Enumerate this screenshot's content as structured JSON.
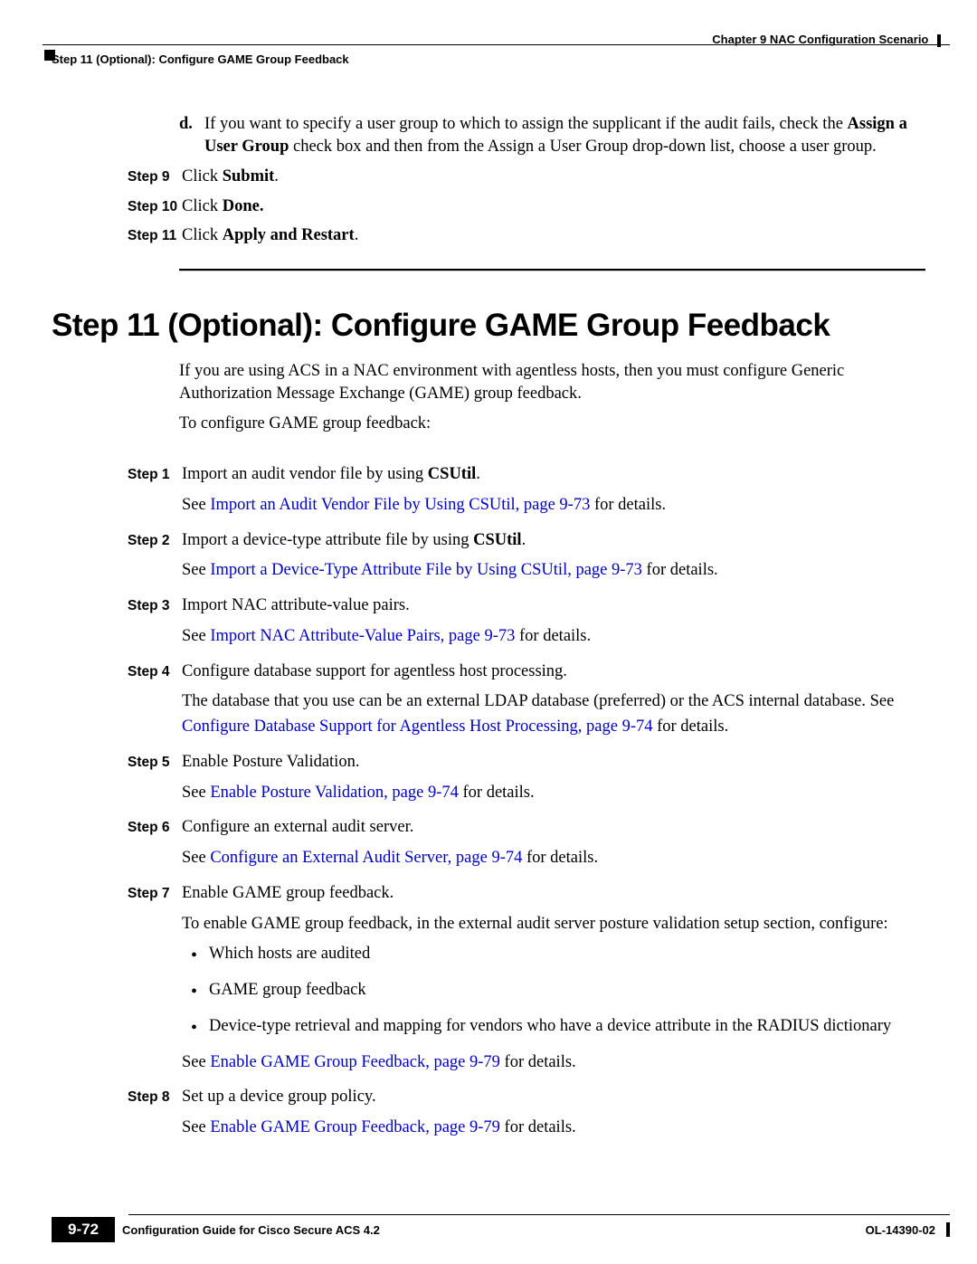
{
  "header": {
    "chapter": "Chapter 9    NAC Configuration Scenario",
    "section": "Step 11 (Optional): Configure GAME Group Feedback"
  },
  "prior": {
    "subD": {
      "marker": "d.",
      "pre": "If you want to specify a user group to which to assign the supplicant if the audit fails, check the ",
      "bold": "Assign a User Group",
      "post": " check box and then from the Assign a User Group drop-down list, choose a user group."
    },
    "steps": [
      {
        "label": "Step 9",
        "pre": "Click ",
        "bold": "Submit",
        "post": "."
      },
      {
        "label": "Step 10",
        "pre": "Click ",
        "bold": "Done.",
        "post": ""
      },
      {
        "label": "Step 11",
        "pre": "Click ",
        "bold": "Apply and Restart",
        "post": "."
      }
    ]
  },
  "title": "Step 11 (Optional): Configure GAME Group Feedback",
  "intro": [
    "If you are using ACS in a NAC environment with agentless hosts, then you must configure Generic Authorization Message Exchange (GAME) group feedback.",
    "To configure GAME group feedback:"
  ],
  "mainSteps": {
    "s1": {
      "label": "Step 1",
      "line1_pre": "Import an audit vendor file by using ",
      "line1_bold": "CSUtil",
      "line1_post": ".",
      "see_pre": "See ",
      "see_link": "Import an Audit Vendor File by Using CSUtil, page 9-73",
      "see_post": " for details."
    },
    "s2": {
      "label": "Step 2",
      "line1_pre": "Import a device-type attribute file by using ",
      "line1_bold": "CSUtil",
      "line1_post": ".",
      "see_pre": "See ",
      "see_link": "Import a Device-Type Attribute File by Using CSUtil, page 9-73",
      "see_post": " for details."
    },
    "s3": {
      "label": "Step 3",
      "line1": "Import NAC attribute-value pairs.",
      "see_pre": "See ",
      "see_link": "Import NAC Attribute-Value Pairs, page 9-73",
      "see_post": " for details."
    },
    "s4": {
      "label": "Step 4",
      "line1": "Configure database support for agentless host processing.",
      "extra": "The database that you use can be an external LDAP database (preferred) or the ACS internal database. See ",
      "see_link": "Configure Database Support for Agentless Host Processing, page 9-74",
      "see_post": " for details."
    },
    "s5": {
      "label": "Step 5",
      "line1": "Enable Posture Validation.",
      "see_pre": "See ",
      "see_link": "Enable Posture Validation, page 9-74",
      "see_post": " for details."
    },
    "s6": {
      "label": "Step 6",
      "line1": "Configure an external audit server.",
      "see_pre": "See ",
      "see_link": "Configure an External Audit Server, page 9-74",
      "see_post": " for details."
    },
    "s7": {
      "label": "Step 7",
      "line1": "Enable GAME group feedback.",
      "extra": "To enable GAME group feedback, in the external audit server posture validation setup section, configure:",
      "bullets": [
        "Which hosts are audited",
        "GAME group feedback",
        "Device-type retrieval and mapping for vendors who have a device attribute in the RADIUS dictionary"
      ],
      "see_pre": "See ",
      "see_link": "Enable GAME Group Feedback, page 9-79",
      "see_post": " for details."
    },
    "s8": {
      "label": "Step 8",
      "line1": "Set up a device group policy.",
      "see_pre": "See ",
      "see_link": "Enable GAME Group Feedback, page 9-79",
      "see_post": " for details."
    }
  },
  "footer": {
    "title": "Configuration Guide for Cisco Secure ACS 4.2",
    "page": "9-72",
    "docnum": "OL-14390-02"
  }
}
